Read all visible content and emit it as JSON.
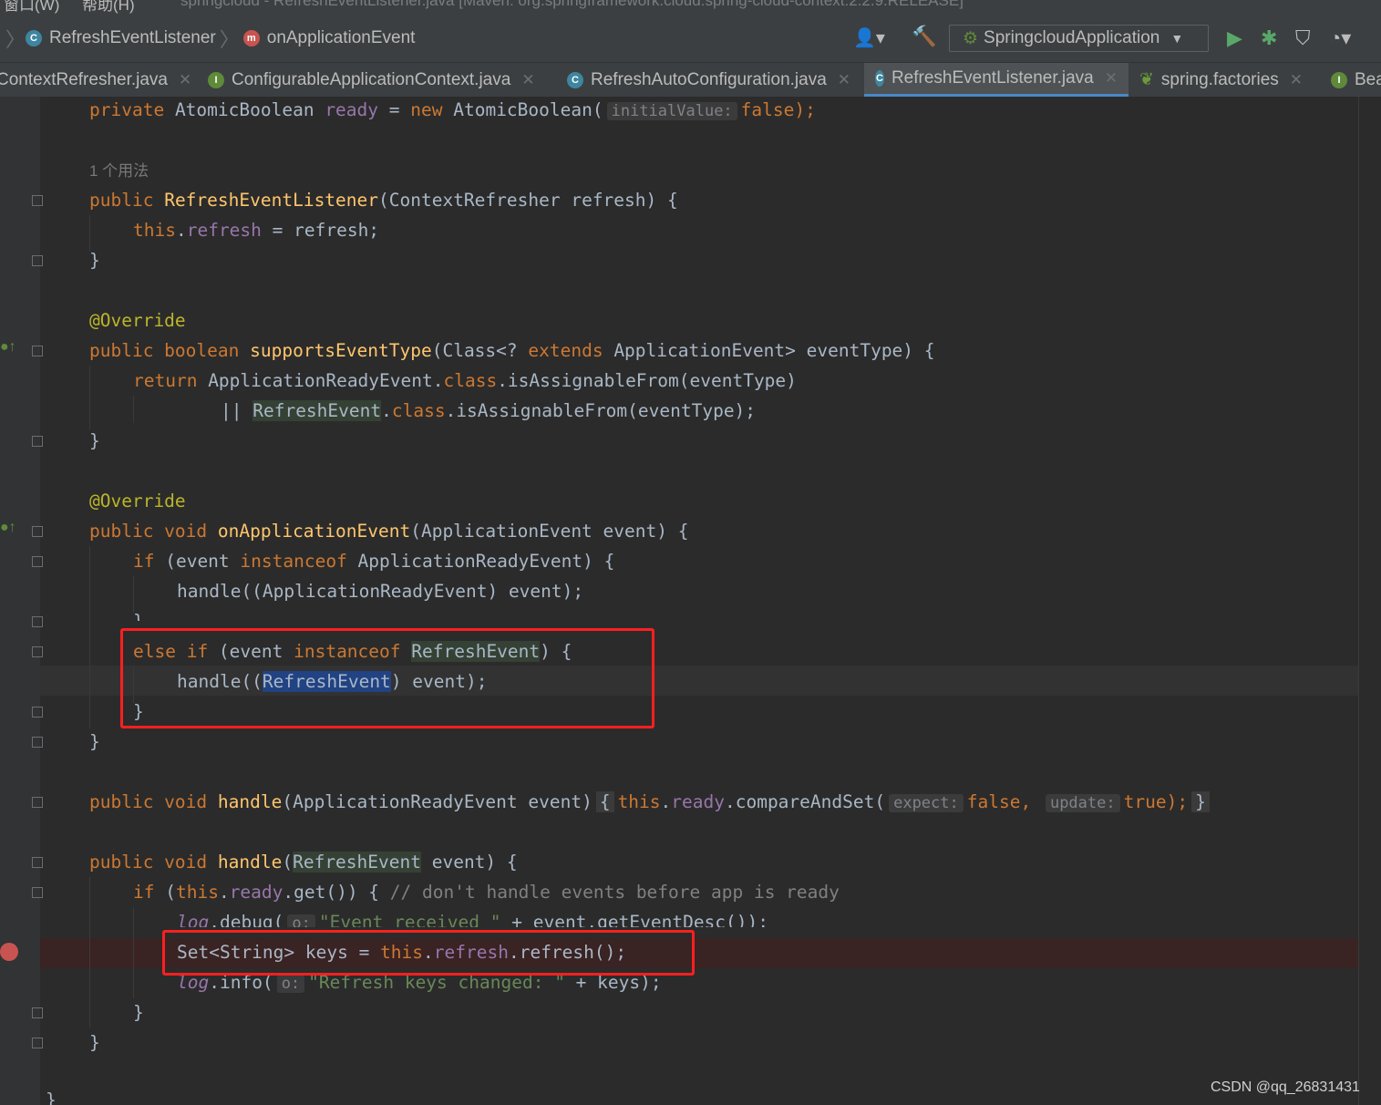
{
  "menubar": {
    "items": [
      "窗口(W)",
      "帮助(H)"
    ],
    "title": "springcloud - RefreshEventListener.java [Maven: org.springframework.cloud:spring-cloud-context:2.2.9.RELEASE]"
  },
  "navbar": {
    "breadcrumb": [
      "RefreshEventListener",
      "onApplicationEvent"
    ],
    "run_config": "SpringcloudApplication"
  },
  "tabs": [
    {
      "label": "ContextRefresher.java",
      "icon": "C",
      "active": false
    },
    {
      "label": "ConfigurableApplicationContext.java",
      "icon": "I",
      "active": false
    },
    {
      "label": "RefreshAutoConfiguration.java",
      "icon": "C",
      "active": false
    },
    {
      "label": "RefreshEventListener.java",
      "icon": "C",
      "active": true
    },
    {
      "label": "spring.factories",
      "icon": "spring-leaf",
      "active": false
    },
    {
      "label": "Bea",
      "icon": "I",
      "active": false
    }
  ],
  "code": {
    "ready_field": {
      "kw": "private",
      "type": "AtomicBoolean",
      "name": "ready",
      "new": "new",
      "ctor": "AtomicBoolean(",
      "hint": "initialValue:",
      "val": "false",
      "end": ");"
    },
    "usages": "1 个用法",
    "ctor_sig": {
      "kw": "public",
      "name": "RefreshEventListener",
      "params": "(ContextRefresher refresh) {"
    },
    "ctor_body": {
      "this": "this",
      "field": "refresh",
      "rest": " = refresh;"
    },
    "close": "}",
    "override": "@Override",
    "supports_sig": {
      "kw": "public boolean",
      "name": "supportsEventType",
      "p1": "(Class<? ",
      "ext": "extends",
      "p2": " ApplicationEvent> eventType) {"
    },
    "supports_ret": {
      "kw": "return",
      "a": " ApplicationReadyEvent.",
      "cls": "class",
      "b": ".isAssignableFrom(eventType)"
    },
    "supports_or": {
      "or": "|| ",
      "type": "RefreshEvent",
      "dot": ".",
      "cls": "class",
      "b": ".isAssignableFrom(eventType);"
    },
    "onapp_sig": {
      "kw": "public void",
      "name": "onApplicationEvent",
      "params": "(ApplicationEvent event) {"
    },
    "if_ready": {
      "kw": "if",
      "a": " (event ",
      "inst": "instanceof",
      "b": " ApplicationReadyEvent) {"
    },
    "handle_ready": "handle((ApplicationReadyEvent) event);",
    "else_if": {
      "kw": "else if",
      "a": " (event ",
      "inst": "instanceof",
      "type": "RefreshEvent",
      "b": ") {"
    },
    "handle_refresh": {
      "a": "handle((",
      "type": "RefreshEvent",
      "b": ") event);"
    },
    "handle1": {
      "kw": "public void",
      "name": "handle",
      "params": "(ApplicationReadyEvent event)",
      "lb": "{",
      "this": "this",
      "field": "ready",
      "call": ".compareAndSet(",
      "hint1": "expect:",
      "v1": "false,",
      "hint2": "update:",
      "v2": "true",
      "end": ");",
      "rb": "}"
    },
    "handle2": {
      "kw": "public void",
      "name": "handle",
      "lp": "(",
      "type": "RefreshEvent",
      "params": " event) {"
    },
    "if_get": {
      "kw": "if",
      "a": " (",
      "this": "this",
      "field": "ready",
      "b": ".get()) { ",
      "comment": "// don't handle events before app is ready"
    },
    "log_debug": {
      "log": "log",
      "a": ".debug(",
      "hint": "o:",
      "str": "\"Event received \"",
      "b": " + event.getEventDesc());"
    },
    "keys_line": {
      "a": "Set<String> keys = ",
      "this": "this",
      "field": "refresh",
      "b": ".refresh();"
    },
    "log_info": {
      "log": "log",
      "a": ".info(",
      "hint": "o:",
      "str": "\"Refresh keys changed: \"",
      "b": " + keys);"
    }
  },
  "watermark": "CSDN @qq_26831431"
}
